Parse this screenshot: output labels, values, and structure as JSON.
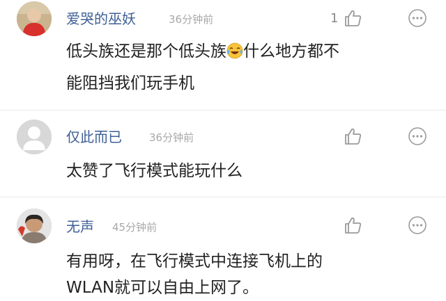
{
  "comments": [
    {
      "username": "爱哭的巫妖",
      "time": "36分钟前",
      "likes": "1",
      "text_lines": [
        "低头族还是那个低头族",
        "什么地方都不",
        "能阻挡我们玩手机"
      ],
      "emoji": "laughing-crying-emoji"
    },
    {
      "username": "仅此而已",
      "time": "36分钟前",
      "likes": "",
      "text_lines": [
        "太赞了飞行模式能玩什么"
      ]
    },
    {
      "username": "无声",
      "time": "45分钟前",
      "likes": "",
      "text_lines": [
        "有用呀，在飞行模式中连接飞机上的",
        "WLAN就可以自由上网了。"
      ]
    }
  ],
  "colors": {
    "username": "#3e5f95",
    "time": "#a8a8a8",
    "text": "#222222",
    "icon": "#9a9a9a"
  }
}
